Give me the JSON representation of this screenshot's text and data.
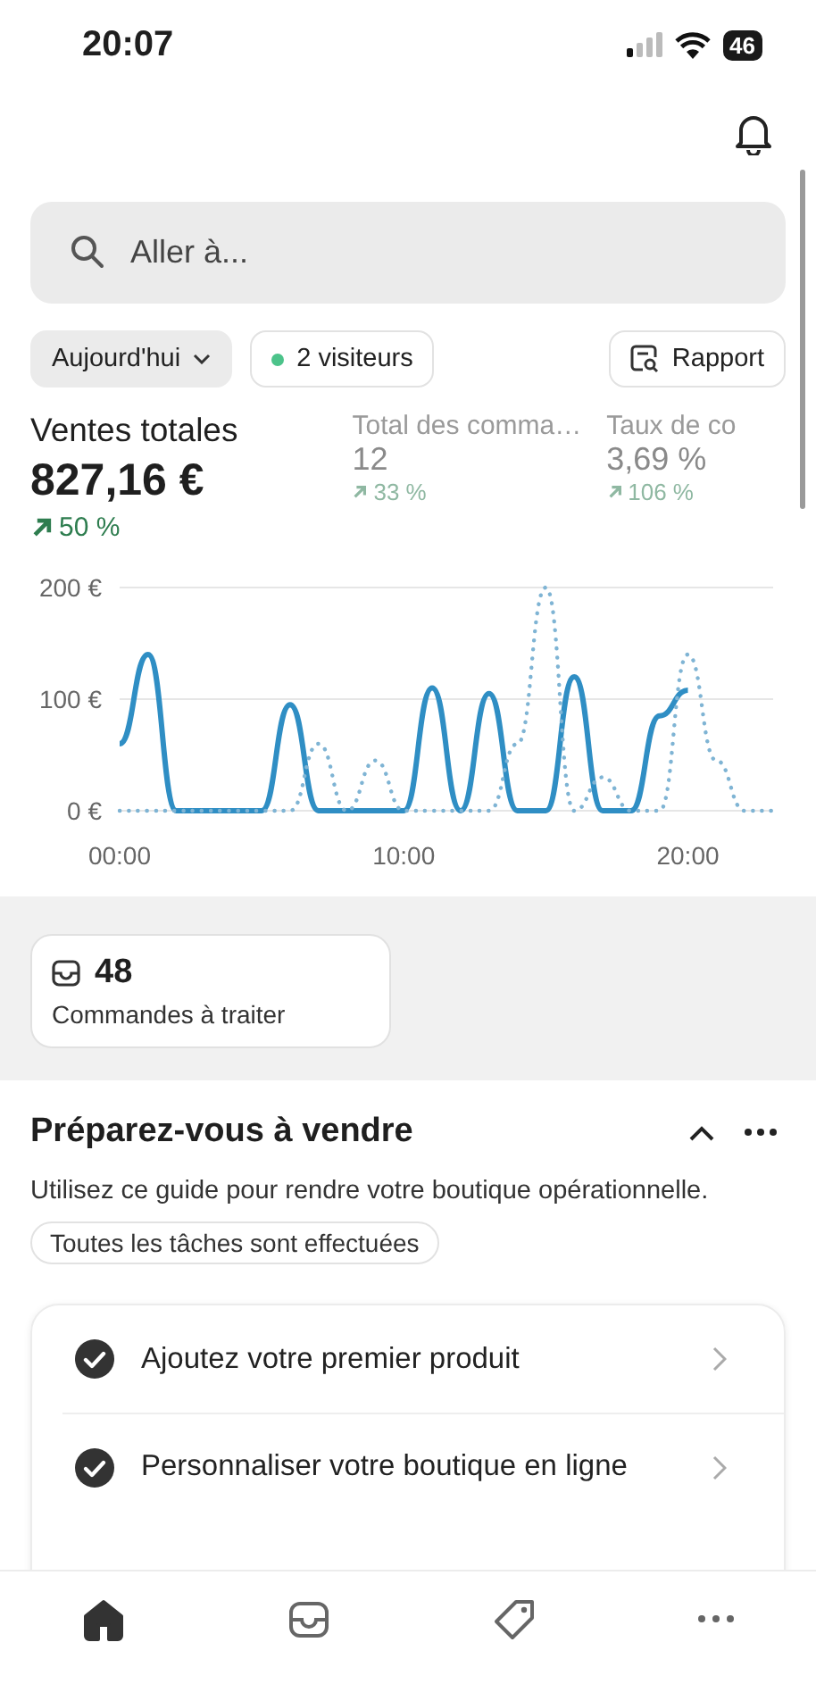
{
  "status_bar": {
    "time": "20:07",
    "battery": "46"
  },
  "search": {
    "placeholder": "Aller à..."
  },
  "filters": [
    {
      "label": "Aujourd'hui",
      "kind": "dropdown"
    },
    {
      "label": "2 visiteurs",
      "kind": "live"
    }
  ],
  "report_button": "Rapport",
  "metrics": [
    {
      "label": "Ventes totales",
      "value": "827,16 €",
      "change": "50 %",
      "selected": true
    },
    {
      "label": "Total des comma…",
      "value": "12",
      "change": "33 %",
      "selected": false
    },
    {
      "label": "Taux de co",
      "value": "3,69 %",
      "change": "106 %",
      "selected": false
    }
  ],
  "chart_data": {
    "type": "line",
    "x": [
      0,
      1,
      2,
      3,
      4,
      5,
      6,
      7,
      8,
      9,
      10,
      11,
      12,
      13,
      14,
      15,
      16,
      17,
      18,
      19,
      20,
      21,
      22,
      23
    ],
    "xlim": [
      0,
      23
    ],
    "ylim": [
      0,
      200
    ],
    "xticks": [
      {
        "value": 0,
        "label": "00:00"
      },
      {
        "value": 10,
        "label": "10:00"
      },
      {
        "value": 20,
        "label": "20:00"
      }
    ],
    "yticks": [
      {
        "value": 0,
        "label": "0 €"
      },
      {
        "value": 100,
        "label": "100 €"
      },
      {
        "value": 200,
        "label": "200 €"
      }
    ],
    "series": [
      {
        "line_style": "solid",
        "color": "#2f8ec4",
        "values": [
          60,
          140,
          0,
          0,
          0,
          0,
          95,
          0,
          0,
          0,
          0,
          110,
          0,
          105,
          0,
          0,
          120,
          0,
          0,
          85,
          108,
          null,
          null,
          null
        ]
      },
      {
        "line_style": "dotted",
        "color": "#7fb4d4",
        "values": [
          0,
          0,
          0,
          0,
          0,
          0,
          0,
          60,
          0,
          45,
          0,
          0,
          0,
          0,
          60,
          200,
          0,
          30,
          0,
          0,
          140,
          45,
          0,
          0
        ]
      }
    ]
  },
  "orders_card": {
    "count": "48",
    "label": "Commandes à traiter"
  },
  "guide": {
    "title": "Préparez-vous à vendre",
    "expanded": true,
    "description": "Utilisez ce guide pour rendre votre boutique opérationnelle.",
    "status": "Toutes les tâches sont effectuées",
    "tasks": [
      {
        "label": "Ajoutez votre premier produit",
        "done": true
      },
      {
        "label": "Personnaliser votre boutique en ligne",
        "done": true
      }
    ]
  },
  "nav": [
    {
      "kind": "home",
      "selected": true
    },
    {
      "kind": "orders",
      "selected": false
    },
    {
      "kind": "products",
      "selected": false
    },
    {
      "kind": "more",
      "selected": false
    }
  ]
}
